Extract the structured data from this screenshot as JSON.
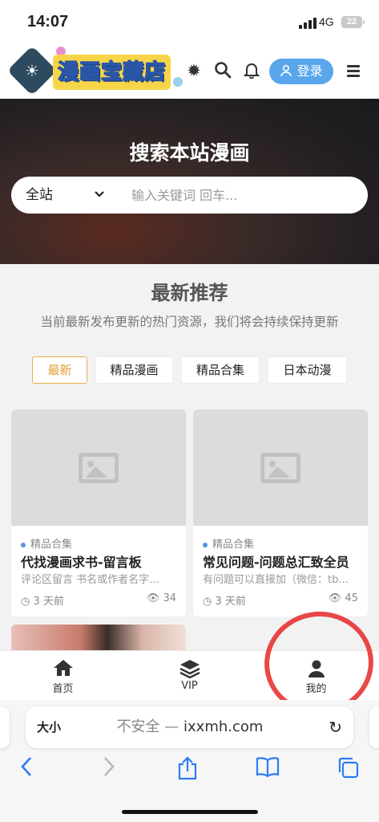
{
  "status_bar": {
    "time": "14:07",
    "network": "4G",
    "battery": "22"
  },
  "header": {
    "logo_text": "漫画宝藏店",
    "login_label": "登录"
  },
  "hero": {
    "title": "搜索本站漫画",
    "scope": "全站",
    "placeholder": "输入关键词 回车..."
  },
  "section": {
    "title": "最新推荐",
    "subtitle": "当前最新发布更新的热门资源，我们将会持续保持更新"
  },
  "tabs": [
    {
      "label": "最新",
      "active": true
    },
    {
      "label": "精品漫画",
      "active": false
    },
    {
      "label": "精品合集",
      "active": false
    },
    {
      "label": "日本动漫",
      "active": false
    }
  ],
  "cards": [
    {
      "category": "精品合集",
      "title": "代找漫画求书-留言板",
      "desc": "评论区留言 书名或作者名字...",
      "date": "3 天前",
      "views": "34"
    },
    {
      "category": "精品合集",
      "title": "常见问题-问题总汇致全员",
      "desc": "有问题可以直接加（微信：tb...",
      "date": "3 天前",
      "views": "45"
    }
  ],
  "tabbar": [
    {
      "label": "首页",
      "icon": "home-icon"
    },
    {
      "label": "VIP",
      "icon": "layers-icon"
    },
    {
      "label": "我的",
      "icon": "user-icon"
    }
  ],
  "browser": {
    "aa_label": "大小",
    "insecure_label": "不安全 — ",
    "domain": "ixxmh.com"
  },
  "colors": {
    "accent": "#5aa6ec",
    "active_tab": "#e0a030",
    "annotation": "#e62828"
  }
}
